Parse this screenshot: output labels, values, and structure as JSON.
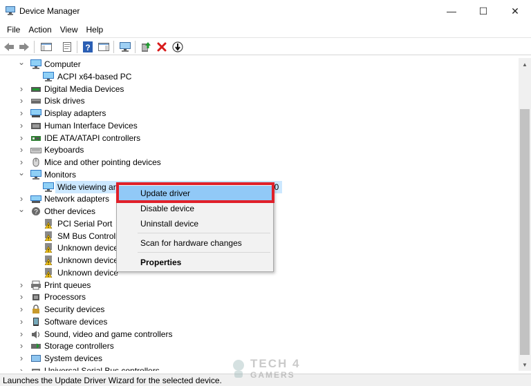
{
  "window": {
    "title": "Device Manager",
    "controls": {
      "minimize": "—",
      "maximize": "☐",
      "close": "✕"
    }
  },
  "menu": [
    "File",
    "Action",
    "View",
    "Help"
  ],
  "toolbar": [
    "back-icon",
    "forward-icon",
    "show-hide-console-tree-icon",
    "properties-icon",
    "help-icon",
    "action-pane-icon",
    "scan-hardware-icon",
    "update-driver-icon",
    "uninstall-icon",
    "disable-device-icon"
  ],
  "tree": {
    "rows": [
      {
        "label": "Computer",
        "expanded": true,
        "icon": "computer-icon"
      },
      {
        "label": "ACPI x64-based PC",
        "icon": "computer-icon"
      },
      {
        "label": "Digital Media Devices",
        "icon": "media-device-icon"
      },
      {
        "label": "Disk drives",
        "icon": "disk-drive-icon"
      },
      {
        "label": "Display adapters",
        "icon": "display-adapter-icon"
      },
      {
        "label": "Human Interface Devices",
        "icon": "hid-icon"
      },
      {
        "label": "IDE ATA/ATAPI controllers",
        "icon": "ide-controller-icon"
      },
      {
        "label": "Keyboards",
        "icon": "keyboard-icon"
      },
      {
        "label": "Mice and other pointing devices",
        "icon": "mouse-icon"
      },
      {
        "label": "Monitors",
        "expanded": true,
        "icon": "monitor-icon"
      },
      {
        "label": "Wide viewing an",
        "suffix": "40",
        "icon": "monitor-icon",
        "selected": true
      },
      {
        "label": "Network adapters",
        "icon": "network-adapter-icon"
      },
      {
        "label": "Other devices",
        "expanded": true,
        "icon": "other-devices-icon"
      },
      {
        "label": "PCI Serial Port",
        "icon": "warning-device-icon"
      },
      {
        "label": "SM Bus Controlle",
        "icon": "warning-device-icon"
      },
      {
        "label": "Unknown device",
        "icon": "warning-device-icon"
      },
      {
        "label": "Unknown device",
        "icon": "warning-device-icon"
      },
      {
        "label": "Unknown device",
        "icon": "warning-device-icon"
      },
      {
        "label": "Print queues",
        "icon": "printer-icon"
      },
      {
        "label": "Processors",
        "icon": "processor-icon"
      },
      {
        "label": "Security devices",
        "icon": "security-device-icon"
      },
      {
        "label": "Software devices",
        "icon": "software-device-icon"
      },
      {
        "label": "Sound, video and game controllers",
        "icon": "sound-icon"
      },
      {
        "label": "Storage controllers",
        "icon": "storage-controller-icon"
      },
      {
        "label": "System devices",
        "icon": "system-device-icon"
      },
      {
        "label": "Universal Serial Bus controllers",
        "icon": "usb-icon"
      }
    ]
  },
  "context_menu": {
    "items": [
      {
        "label": "Update driver",
        "highlighted": true
      },
      {
        "label": "Disable device"
      },
      {
        "label": "Uninstall device"
      },
      {
        "label": "Scan for hardware changes"
      },
      {
        "label": "Properties",
        "bold": true
      }
    ],
    "annotation_color": "#e0202a"
  },
  "status": {
    "text": "Launches the Update Driver Wizard for the selected device."
  },
  "watermark": {
    "line1": "TECH 4",
    "line2": "GAMERS"
  },
  "colors": {
    "selection": "#cce8ff",
    "menu_highlight": "#91c9f7",
    "highlight_frame": "#e0202a"
  }
}
